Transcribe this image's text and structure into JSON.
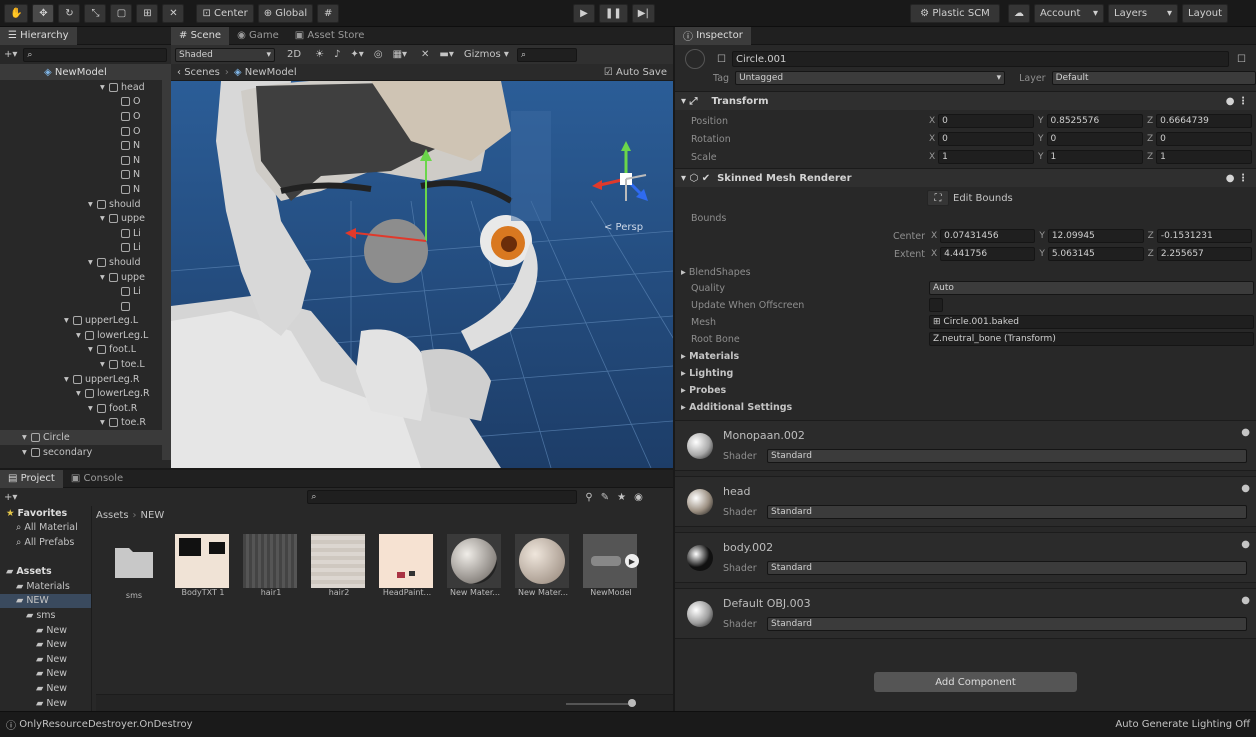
{
  "toolbar": {
    "center": "Center",
    "global": "Global",
    "plastic": "Plastic SCM",
    "account": "Account",
    "layers": "Layers",
    "layout": "Layout"
  },
  "hierarchy": {
    "tab": "Hierarchy",
    "root": "NewModel",
    "rows": [
      {
        "t": "head",
        "d": 5
      },
      {
        "t": "O",
        "d": 6
      },
      {
        "t": "O",
        "d": 6
      },
      {
        "t": "O",
        "d": 6
      },
      {
        "t": "N",
        "d": 6
      },
      {
        "t": "N",
        "d": 6
      },
      {
        "t": "N",
        "d": 6
      },
      {
        "t": "N",
        "d": 6
      },
      {
        "t": "should",
        "d": 4
      },
      {
        "t": "uppe",
        "d": 5
      },
      {
        "t": "Li",
        "d": 6
      },
      {
        "t": "Li",
        "d": 6
      },
      {
        "t": "should",
        "d": 4
      },
      {
        "t": "uppe",
        "d": 5
      },
      {
        "t": "Li",
        "d": 6
      },
      {
        "t": "",
        "d": 6
      },
      {
        "t": "upperLeg.L",
        "d": 2
      },
      {
        "t": "lowerLeg.L",
        "d": 3
      },
      {
        "t": "foot.L",
        "d": 4
      },
      {
        "t": "toe.L",
        "d": 5
      },
      {
        "t": "upperLeg.R",
        "d": 2
      },
      {
        "t": "lowerLeg.R",
        "d": 3
      },
      {
        "t": "foot.R",
        "d": 4
      },
      {
        "t": "toe.R",
        "d": 5
      },
      {
        "t": "Circle",
        "d": 1
      },
      {
        "t": "secondary",
        "d": 1
      }
    ]
  },
  "scene": {
    "tabs": [
      "Scene",
      "Game",
      "Asset Store"
    ],
    "shading": "Shaded",
    "mode": "2D",
    "gizmos": "Gizmos",
    "breadcrumb_scenes": "Scenes",
    "breadcrumb_model": "NewModel",
    "auto_save": "Auto Save",
    "persp": "< Persp"
  },
  "project": {
    "tabs": [
      "Project",
      "Console"
    ],
    "tree": [
      {
        "t": "Favorites",
        "b": true,
        "d": 0
      },
      {
        "t": "All Material",
        "d": 1
      },
      {
        "t": "All Prefabs",
        "d": 1
      },
      {
        "t": "",
        "d": 0
      },
      {
        "t": "Assets",
        "b": true,
        "d": 0
      },
      {
        "t": "Materials",
        "d": 1
      },
      {
        "t": "NEW",
        "d": 1
      },
      {
        "t": "sms",
        "d": 2
      },
      {
        "t": "New",
        "d": 3
      },
      {
        "t": "New",
        "d": 3
      },
      {
        "t": "New",
        "d": 3
      },
      {
        "t": "New",
        "d": 3
      },
      {
        "t": "New",
        "d": 3
      },
      {
        "t": "New",
        "d": 3
      }
    ],
    "breadcrumb_assets": "Assets",
    "breadcrumb_new": "NEW",
    "assets": [
      "sms",
      "BodyTXT 1",
      "hair1",
      "hair2",
      "HeadPaint...",
      "New Mater...",
      "New Mater...",
      "NewModel"
    ]
  },
  "status": {
    "left": "OnlyResourceDestroyer.OnDestroy",
    "right": "Auto Generate Lighting Off"
  },
  "inspector": {
    "tab": "Inspector",
    "name": "Circle.001",
    "tag_label": "Tag",
    "tag": "Untagged",
    "layer_label": "Layer",
    "layer": "Default",
    "transform": {
      "title": "Transform",
      "rows": [
        {
          "label": "Position",
          "x": "0",
          "y": "0.8525576",
          "z": "0.6664739"
        },
        {
          "label": "Rotation",
          "x": "0",
          "y": "0",
          "z": "0"
        },
        {
          "label": "Scale",
          "x": "1",
          "y": "1",
          "z": "1"
        }
      ]
    },
    "smr": {
      "title": "Skinned Mesh Renderer",
      "edit_bounds": "Edit Bounds",
      "bounds": "Bounds",
      "center": {
        "label": "Center",
        "x": "0.07431456",
        "y": "12.09945",
        "z": "-0.1531231"
      },
      "extent": {
        "label": "Extent",
        "x": "4.441756",
        "y": "5.063145",
        "z": "2.255657"
      },
      "blendshapes": "BlendShapes",
      "quality_label": "Quality",
      "quality": "Auto",
      "update_label": "Update When Offscreen",
      "mesh_label": "Mesh",
      "mesh": "Circle.001.baked",
      "root_label": "Root Bone",
      "root": "Z.neutral_bone (Transform)",
      "materials": "Materials",
      "lighting": "Lighting",
      "probes": "Probes",
      "additional": "Additional Settings"
    },
    "materials": [
      {
        "name": "Monopaan.002",
        "shader_label": "Shader",
        "shader": "Standard",
        "color": "#a9a9a9"
      },
      {
        "name": "head",
        "shader_label": "Shader",
        "shader": "Standard",
        "color": "#9c9082"
      },
      {
        "name": "body.002",
        "shader_label": "Shader",
        "shader": "Standard",
        "color": "#111111"
      },
      {
        "name": "Default OBJ.003",
        "shader_label": "Shader",
        "shader": "Standard",
        "color": "#9d9d9d"
      }
    ],
    "add_component": "Add Component"
  }
}
